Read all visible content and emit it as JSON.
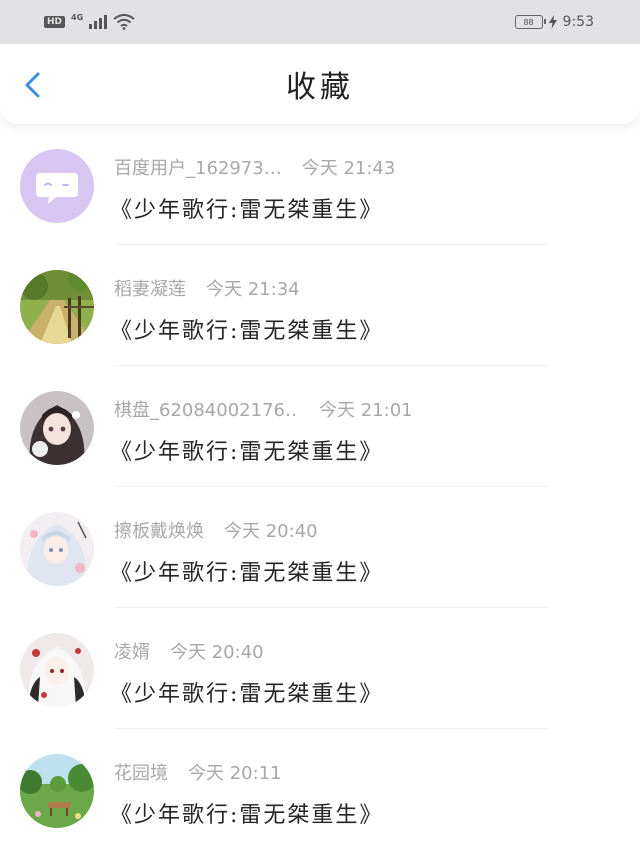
{
  "status_bar": {
    "hd": "HD",
    "network": "4G",
    "battery": "88",
    "time": "9:53"
  },
  "header": {
    "title": "收藏"
  },
  "items": [
    {
      "user": "百度用户_162973…",
      "time": "今天 21:43",
      "book": "《少年歌行:雷无桀重生》",
      "avatar": "chat-bubble"
    },
    {
      "user": "稻妻凝莲",
      "time": "今天 21:34",
      "book": "《少年歌行:雷无桀重生》",
      "avatar": "park-path"
    },
    {
      "user": "棋盘_62084002176…",
      "time": "今天 21:01",
      "book": "《少年歌行:雷无桀重生》",
      "avatar": "anime-girl-dark"
    },
    {
      "user": "擦板戴焕焕",
      "time": "今天 20:40",
      "book": "《少年歌行:雷无桀重生》",
      "avatar": "anime-girl-light"
    },
    {
      "user": "凌婿",
      "time": "今天 20:40",
      "book": "《少年歌行:雷无桀重生》",
      "avatar": "anime-white-hair"
    },
    {
      "user": "花园境",
      "time": "今天 20:11",
      "book": "《少年歌行:雷无桀重生》",
      "avatar": "garden"
    }
  ],
  "colors": {
    "accent": "#3a8ee6",
    "avatar_purple": "#d7c6f2"
  }
}
